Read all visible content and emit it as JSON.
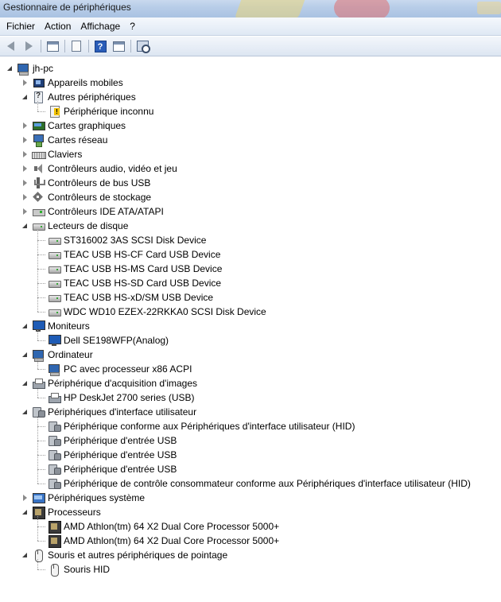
{
  "window": {
    "title": "Gestionnaire de périphériques"
  },
  "menu": {
    "items": [
      "Fichier",
      "Action",
      "Affichage",
      "?"
    ]
  },
  "toolbar": {
    "buttons": [
      "back-icon",
      "forward-icon",
      "properties-window-icon",
      "document-icon",
      "help-icon",
      "panel-icon",
      "scan-hardware-icon"
    ]
  },
  "tree": {
    "root": "jh-pc",
    "categories": [
      {
        "label": "Appareils mobiles",
        "icon": "mobile-device-icon",
        "expanded": false,
        "children": []
      },
      {
        "label": "Autres périphériques",
        "icon": "other-devices-icon",
        "expanded": true,
        "children": [
          {
            "label": "Périphérique inconnu",
            "icon": "unknown-device-icon"
          }
        ]
      },
      {
        "label": "Cartes graphiques",
        "icon": "display-adapter-icon",
        "expanded": false,
        "children": []
      },
      {
        "label": "Cartes réseau",
        "icon": "network-adapter-icon",
        "expanded": false,
        "children": []
      },
      {
        "label": "Claviers",
        "icon": "keyboard-icon",
        "expanded": false,
        "children": []
      },
      {
        "label": "Contrôleurs audio, vidéo et jeu",
        "icon": "audio-icon",
        "expanded": false,
        "children": []
      },
      {
        "label": "Contrôleurs de bus USB",
        "icon": "usb-icon",
        "expanded": false,
        "children": []
      },
      {
        "label": "Contrôleurs de stockage",
        "icon": "storage-controller-icon",
        "expanded": false,
        "children": []
      },
      {
        "label": "Contrôleurs IDE ATA/ATAPI",
        "icon": "ide-controller-icon",
        "expanded": false,
        "children": []
      },
      {
        "label": "Lecteurs de disque",
        "icon": "disk-drive-icon",
        "expanded": true,
        "children": [
          {
            "label": "ST316002 3AS SCSI Disk Device",
            "icon": "disk-icon"
          },
          {
            "label": "TEAC USB   HS-CF Card USB Device",
            "icon": "disk-icon"
          },
          {
            "label": "TEAC USB   HS-MS Card USB Device",
            "icon": "disk-icon"
          },
          {
            "label": "TEAC USB   HS-SD Card USB Device",
            "icon": "disk-icon"
          },
          {
            "label": "TEAC USB   HS-xD/SM USB Device",
            "icon": "disk-icon"
          },
          {
            "label": "WDC WD10 EZEX-22RKKA0 SCSI Disk Device",
            "icon": "disk-icon"
          }
        ]
      },
      {
        "label": "Moniteurs",
        "icon": "monitor-icon",
        "expanded": true,
        "children": [
          {
            "label": "Dell SE198WFP(Analog)",
            "icon": "monitor-icon"
          }
        ]
      },
      {
        "label": "Ordinateur",
        "icon": "computer-icon",
        "expanded": true,
        "children": [
          {
            "label": "PC avec processeur x86 ACPI",
            "icon": "computer-icon"
          }
        ]
      },
      {
        "label": "Périphérique d'acquisition d'images",
        "icon": "imaging-device-icon",
        "expanded": true,
        "children": [
          {
            "label": "HP DeskJet 2700 series (USB)",
            "icon": "printer-icon"
          }
        ]
      },
      {
        "label": "Périphériques d'interface utilisateur",
        "icon": "hid-icon",
        "expanded": true,
        "children": [
          {
            "label": "Périphérique conforme aux Périphériques d'interface utilisateur (HID)",
            "icon": "hid-icon"
          },
          {
            "label": "Périphérique d'entrée USB",
            "icon": "hid-icon"
          },
          {
            "label": "Périphérique d'entrée USB",
            "icon": "hid-icon"
          },
          {
            "label": "Périphérique d'entrée USB",
            "icon": "hid-icon"
          },
          {
            "label": "Périphérique de contrôle consommateur conforme aux Périphériques d'interface utilisateur (HID)",
            "icon": "hid-icon"
          }
        ]
      },
      {
        "label": "Périphériques système",
        "icon": "system-device-icon",
        "expanded": false,
        "children": []
      },
      {
        "label": "Processeurs",
        "icon": "processor-icon",
        "expanded": true,
        "children": [
          {
            "label": "AMD Athlon(tm) 64 X2 Dual Core Processor 5000+",
            "icon": "processor-icon"
          },
          {
            "label": "AMD Athlon(tm) 64 X2 Dual Core Processor 5000+",
            "icon": "processor-icon"
          }
        ]
      },
      {
        "label": "Souris et autres périphériques de pointage",
        "icon": "mouse-icon",
        "expanded": true,
        "children": [
          {
            "label": "Souris HID",
            "icon": "mouse-icon"
          }
        ]
      }
    ]
  }
}
